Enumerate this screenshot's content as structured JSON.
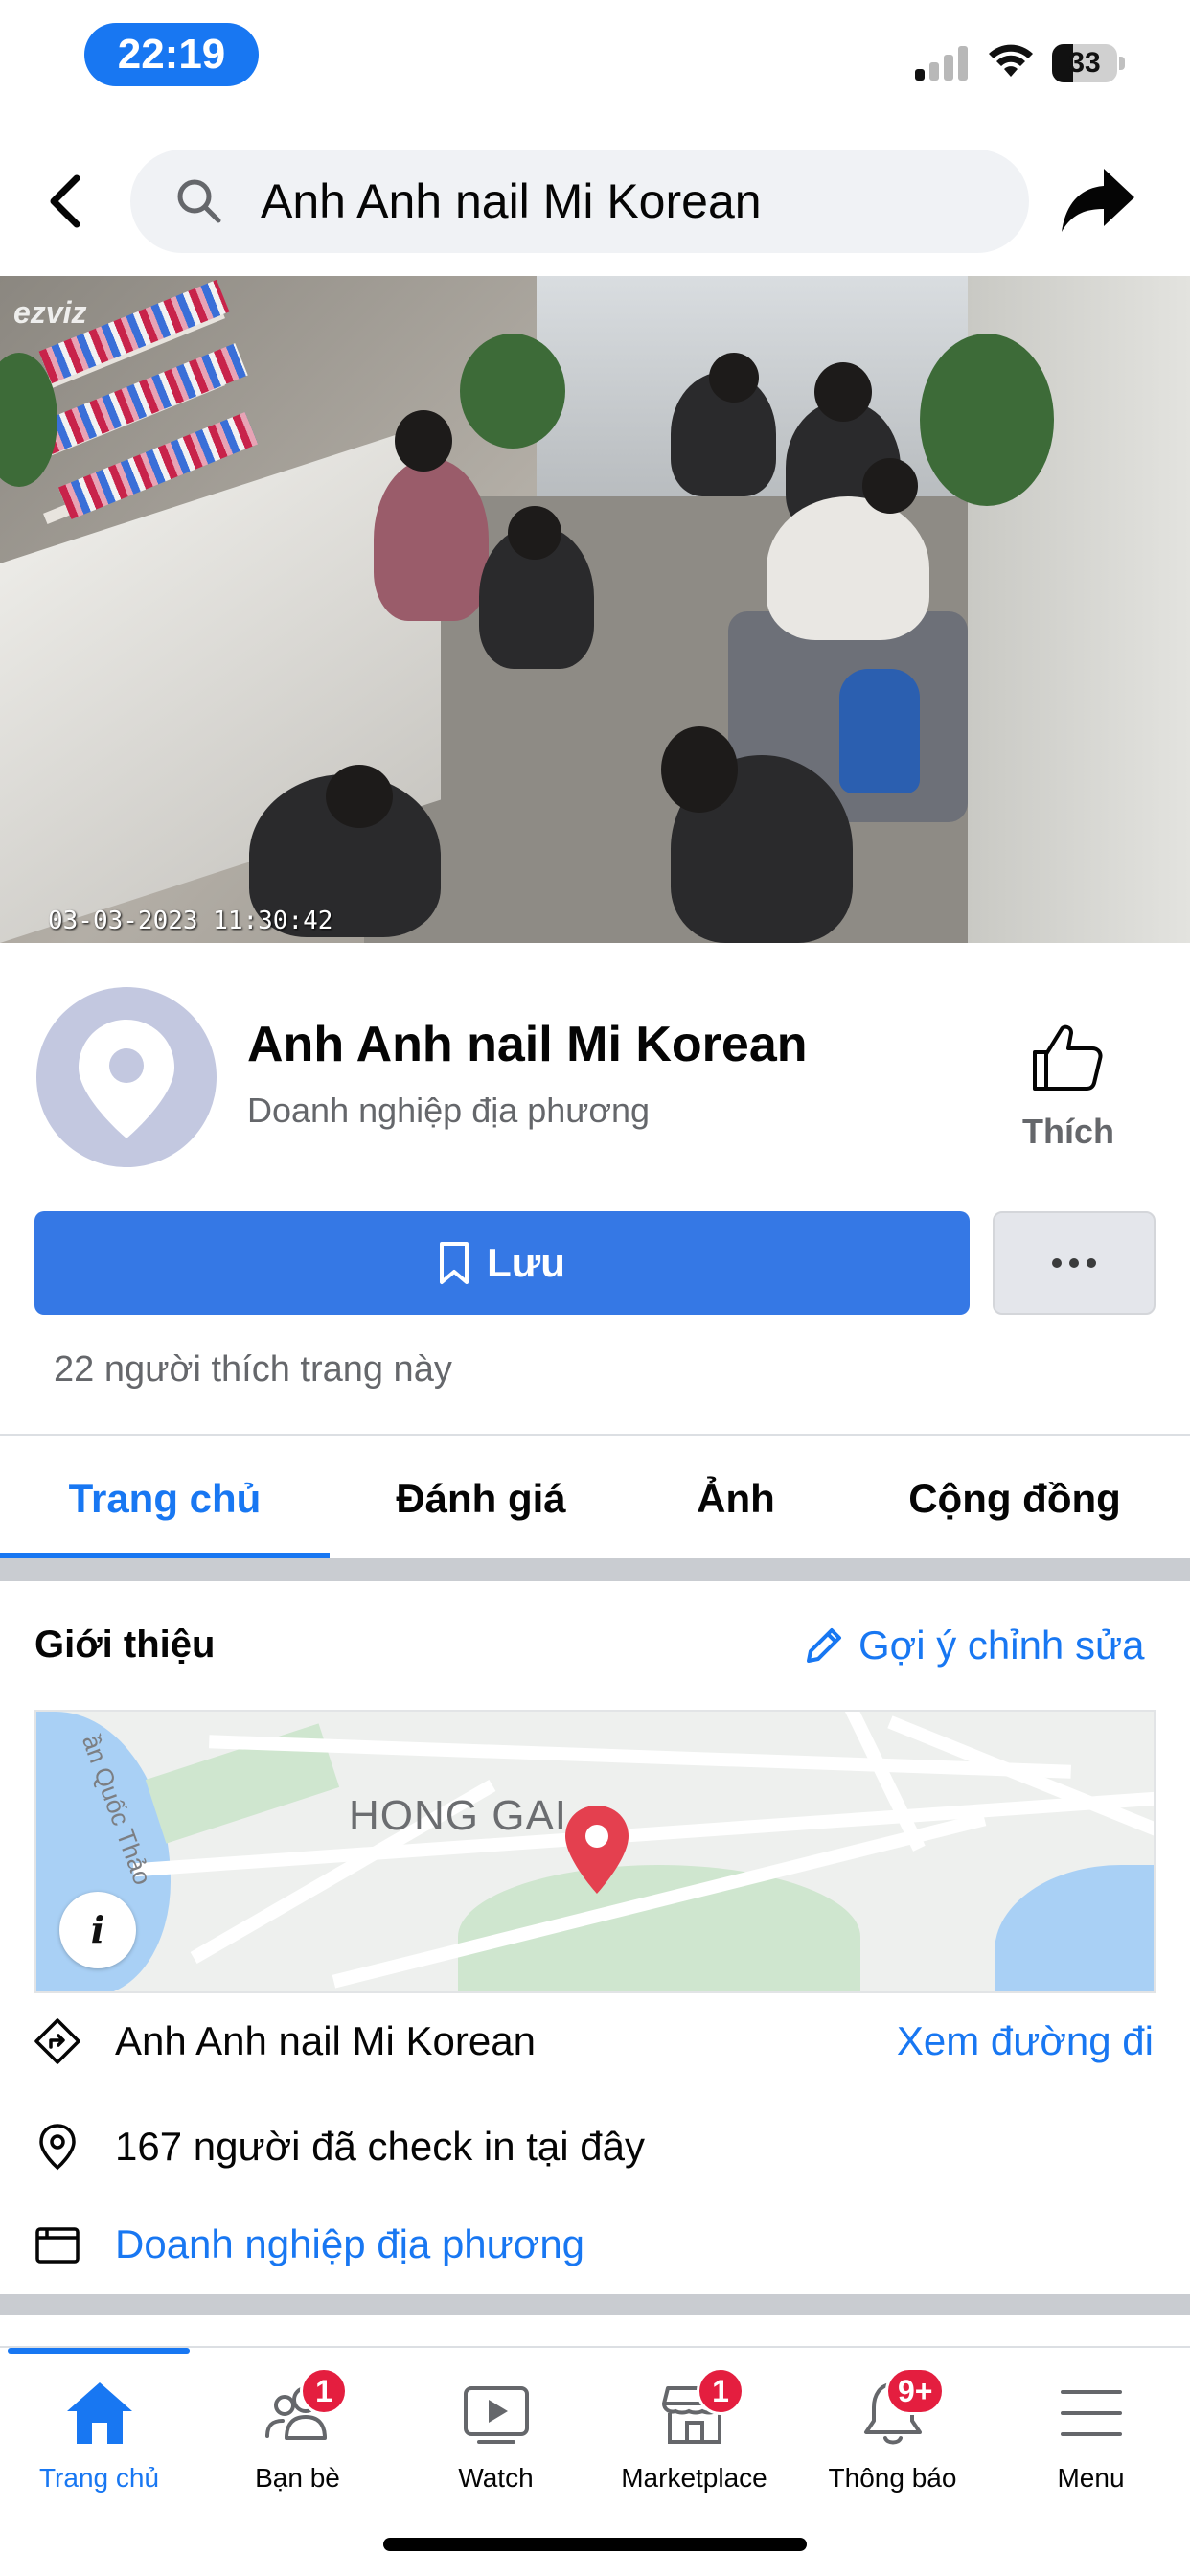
{
  "status_bar": {
    "time": "22:19",
    "battery": "33"
  },
  "header": {
    "search_text": "Anh Anh nail Mi Korean"
  },
  "cover": {
    "brand": "ezviz",
    "timestamp": "03-03-2023 11:30:42"
  },
  "profile": {
    "name": "Anh Anh nail Mi Korean",
    "category": "Doanh nghiệp địa phương",
    "like_label": "Thích"
  },
  "actions": {
    "save_label": "Lưu"
  },
  "likes_text": "22 người thích trang này",
  "tabs": [
    {
      "label": "Trang chủ",
      "active": true
    },
    {
      "label": "Đánh giá",
      "active": false
    },
    {
      "label": "Ảnh",
      "active": false
    },
    {
      "label": "Cộng đồng",
      "active": false
    }
  ],
  "intro": {
    "title": "Giới thiệu",
    "suggest_edit": "Gợi ý chỉnh sửa",
    "map_area": "HONG GAI",
    "map_street": "ần Quốc Thảo",
    "rows": [
      {
        "icon": "directions-icon",
        "text": "Anh Anh nail Mi Korean",
        "action": "Xem đường đi"
      },
      {
        "icon": "location-pin-icon",
        "text": "167 người đã check in tại đây"
      },
      {
        "icon": "category-icon",
        "text": "Doanh nghiệp địa phương"
      }
    ]
  },
  "bottom_nav": [
    {
      "label": "Trang chủ",
      "icon": "home-icon",
      "active": true,
      "badge": ""
    },
    {
      "label": "Bạn bè",
      "icon": "friends-icon",
      "active": false,
      "badge": "1"
    },
    {
      "label": "Watch",
      "icon": "watch-icon",
      "active": false,
      "badge": ""
    },
    {
      "label": "Marketplace",
      "icon": "marketplace-icon",
      "active": false,
      "badge": "1"
    },
    {
      "label": "Thông báo",
      "icon": "bell-icon",
      "active": false,
      "badge": "9+"
    },
    {
      "label": "Menu",
      "icon": "menu-icon",
      "active": false,
      "badge": ""
    }
  ],
  "colors": {
    "accent": "#1877f2",
    "save_button": "#3578e5",
    "badge": "#e41e3f",
    "secondary_text": "#65676b"
  }
}
